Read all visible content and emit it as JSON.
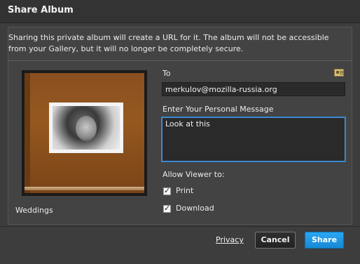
{
  "dialog": {
    "title": "Share Album",
    "description": "Sharing this private album will create a URL for it. The album will not be accessible from your Gallery, but it will no longer be completely secure."
  },
  "album": {
    "name": "Weddings"
  },
  "form": {
    "to_label": "To",
    "to_value": "merkulov@mozilla-russia.org",
    "message_label": "Enter Your Personal Message",
    "message_value": "Look at this",
    "allow_label": "Allow Viewer to:",
    "options": [
      {
        "label": "Print",
        "checked": true
      },
      {
        "label": "Download",
        "checked": true
      }
    ]
  },
  "footer": {
    "privacy_label": "Privacy",
    "cancel_label": "Cancel",
    "share_label": "Share"
  },
  "colors": {
    "accent": "#1d96e6",
    "focus_border": "#4a90d9"
  },
  "icons": {
    "address_book": "address-book-icon",
    "checkbox": "checkmark-icon"
  }
}
